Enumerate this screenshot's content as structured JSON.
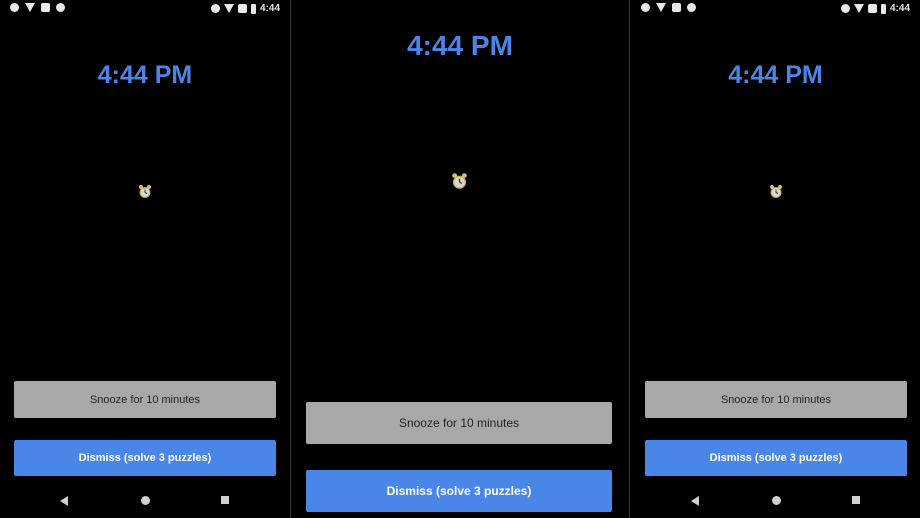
{
  "screens": [
    {
      "status_time": "4:44",
      "clock": "4:44 PM",
      "snooze_label": "Snooze for 10 minutes",
      "dismiss_label": "Dismiss (solve 3 puzzles)"
    },
    {
      "clock": "4:44 PM",
      "snooze_label": "Snooze for 10 minutes",
      "dismiss_label": "Dismiss (solve 3 puzzles)"
    },
    {
      "status_time": "4:44",
      "clock": "4:44 PM",
      "snooze_label": "Snooze for 10 minutes",
      "dismiss_label": "Dismiss (solve 3 puzzles)"
    }
  ],
  "icons": {
    "alarm": "alarm-clock-icon",
    "nav_back": "back-icon",
    "nav_home": "home-icon",
    "nav_recent": "recent-apps-icon"
  },
  "colors": {
    "accent": "#4a86e8",
    "snooze_button": "#a8a8a8",
    "background": "#000000"
  }
}
